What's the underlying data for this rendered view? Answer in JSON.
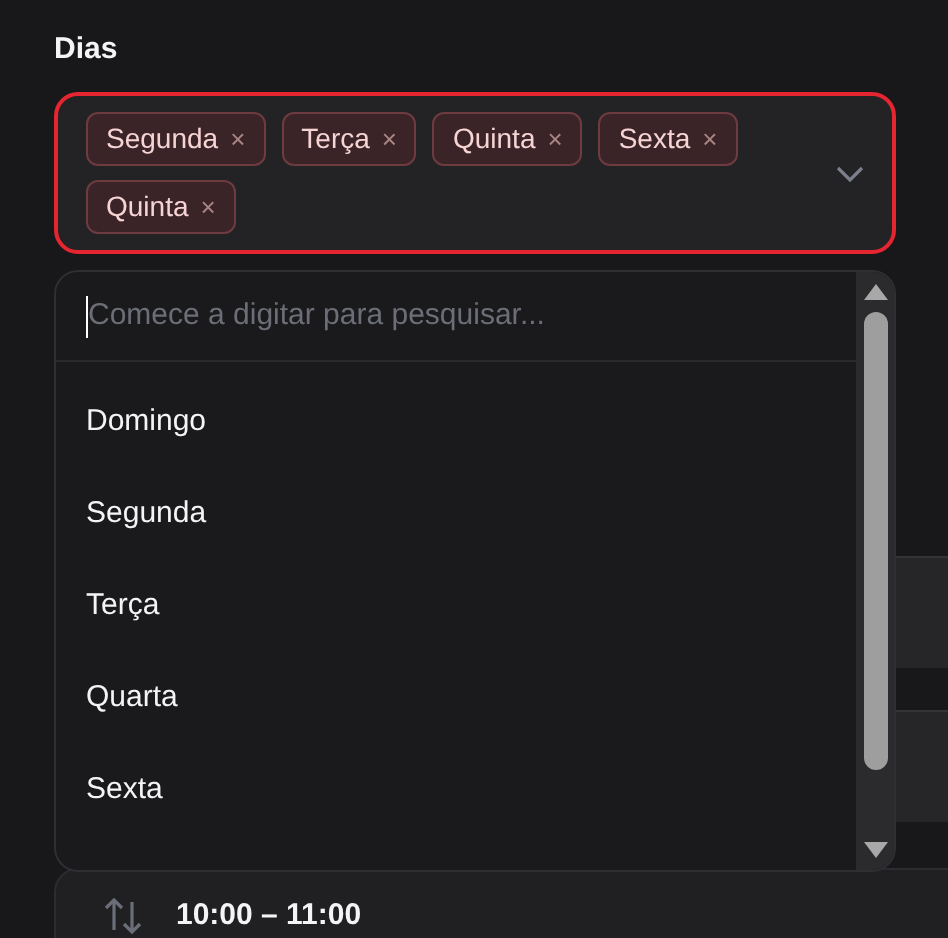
{
  "field": {
    "label": "Dias",
    "tags": [
      {
        "label": "Segunda",
        "remove": "×"
      },
      {
        "label": "Terça",
        "remove": "×"
      },
      {
        "label": "Quinta",
        "remove": "×"
      },
      {
        "label": "Sexta",
        "remove": "×"
      },
      {
        "label": "Quinta",
        "remove": "×"
      }
    ],
    "invalid": true
  },
  "dropdown": {
    "search": {
      "placeholder": "Comece a digitar para pesquisar..."
    },
    "options": [
      "Domingo",
      "Segunda",
      "Terça",
      "Quarta",
      "Sexta"
    ]
  },
  "time_row": {
    "text": "10:00 – 11:00"
  }
}
